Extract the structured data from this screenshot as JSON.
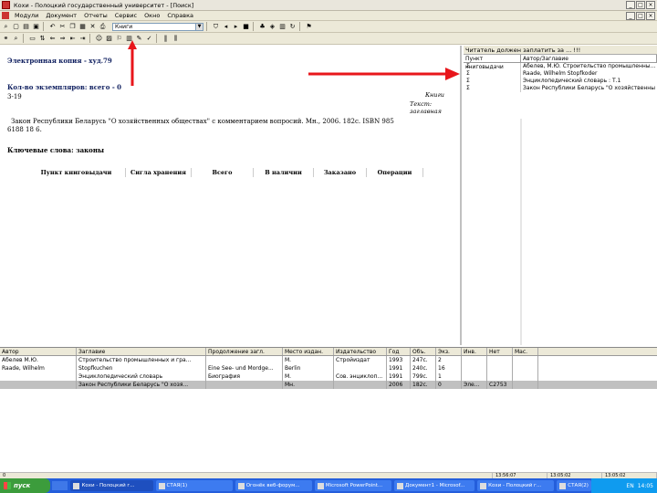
{
  "window": {
    "title": "Кохи - Полоцкий государственный университет - [Поиск]",
    "buttons": [
      "_",
      "□",
      "×"
    ]
  },
  "menubar": {
    "items": [
      "Модули",
      "Документ",
      "Отчеты",
      "Сервис",
      "Окно",
      "Справка"
    ]
  },
  "toolbar": {
    "combo_value": "Книги"
  },
  "book": {
    "electronic_copy": "Электронная копия - худ.79",
    "copies": "Кол-во экземпляров: всего - 0",
    "shelfmark": "3-19",
    "type_label_1": "Книги",
    "type_label_2": "Текст: заглавная",
    "description_line1": "Закон Республики Беларусь \"О хозяйственных обществах\" с комментарием вопросий.   Мн., 2006.   182с.   ISBN 985",
    "description_line2": "6188 18 6.",
    "keywords": "Ключевые слова: законы",
    "table_headers": [
      "Пункт книговыдачи",
      "Сигла хранения",
      "Всего",
      "В наличии",
      "Заказано",
      "Операции"
    ]
  },
  "right_panel": {
    "title": "Читатель должен заплатить за ... !!!",
    "headers": [
      "Пункт книговыдачи",
      "Автор/Заглавие"
    ],
    "rows": [
      {
        "code": "Σ",
        "text": "Абелев, М.Ю.   Строительство промышленны..."
      },
      {
        "code": "Σ",
        "text": "Raade, Wilhelm   Stopfkoder"
      },
      {
        "code": "Σ",
        "text": "Энциклопедический словарь :  Т.1"
      },
      {
        "code": "Σ",
        "text": "Закон Республики Беларусь \"О хозяйственны"
      }
    ]
  },
  "results": {
    "headers": [
      "Автор",
      "Заглавие",
      "Продолжение загл.",
      "Место издан.",
      "Издательство",
      "Год",
      "Объ.",
      "Экз.",
      "Инв.",
      "Нет",
      "Мас."
    ],
    "rows": [
      [
        "Абелев М.Ю.",
        "Строительство промышленных и гра...",
        "",
        "М.",
        "Стройиздат",
        "1993",
        "247с.",
        "2",
        "",
        "",
        ""
      ],
      [
        "Raade, Wilhelm",
        "Stopfkuchen",
        "Eine See- und Mordge...",
        "Berlin",
        "",
        "1991",
        "240с.",
        "16",
        "",
        "",
        ""
      ],
      [
        "",
        "Энциклопедический словарь",
        "Биография",
        "М.",
        "Сов. энциклоп...",
        "1991",
        "799с.",
        "1",
        "",
        "",
        ""
      ],
      [
        "",
        "Закон Республики Беларусь \"О хозя...",
        "",
        "Мн.",
        "",
        "2006",
        "182с.",
        "0",
        "Эле...",
        "C2753",
        ""
      ]
    ]
  },
  "status": [
    "0",
    "13:56:07",
    "",
    "13:05:02",
    "",
    "13:05:02"
  ],
  "taskbar": {
    "start": "пуск",
    "tasks": [
      "Кохи - Полоцкий г...",
      "СТАЯ(1)",
      "Огонёк веб-форум...",
      "Microsoft PowerPoint...",
      "Документ1 - Microsof...",
      "Кохи - Полоцкий г...",
      "СТАЯ(2)"
    ],
    "tray_lang": "EN",
    "clock": "14:05"
  }
}
